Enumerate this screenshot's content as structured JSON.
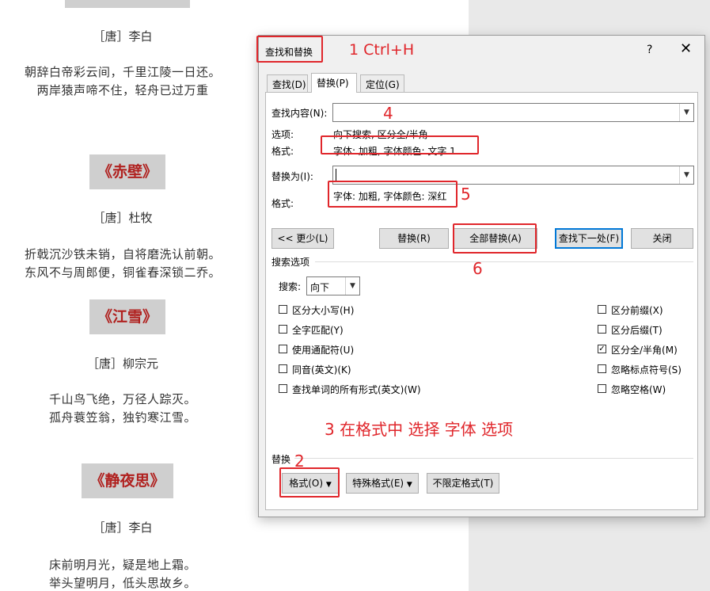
{
  "document": {
    "poems": [
      {
        "author": "［唐］李白",
        "lines": [
          "朝辞白帝彩云间，千里江陵一日还。",
          "两岸猿声啼不住，轻舟已过万重"
        ]
      },
      {
        "title": "《赤壁》",
        "author": "［唐］杜牧",
        "lines": [
          "折戟沉沙铁未销，自将磨洗认前朝。",
          "东风不与周郎便，铜雀春深锁二乔。"
        ]
      },
      {
        "title": "《江雪》",
        "author": "［唐］柳宗元",
        "lines": [
          "千山鸟飞绝，万径人踪灭。",
          "孤舟蓑笠翁，独钓寒江雪。"
        ]
      },
      {
        "title": "《静夜思》",
        "author": "［唐］李白",
        "lines": [
          "床前明月光，疑是地上霜。",
          "举头望明月，低头思故乡。"
        ]
      }
    ]
  },
  "dialog": {
    "title": "查找和替换",
    "help": "?",
    "close": "✕",
    "tabs": [
      "查找(D)",
      "替换(P)",
      "定位(G)"
    ],
    "find_label": "查找内容(N):",
    "find_value": "",
    "options_label": "选项:",
    "options_value": "向下搜索, 区分全/半角",
    "find_format_label": "格式:",
    "find_format_value": "字体: 加粗, 字体颜色: 文字 1",
    "replace_label": "替换为(I):",
    "replace_value": "",
    "replace_format_label": "格式:",
    "replace_format_value": "字体: 加粗, 字体颜色: 深红",
    "buttons": {
      "less": "<< 更少(L)",
      "replace": "替换(R)",
      "replace_all": "全部替换(A)",
      "find_next": "查找下一处(F)",
      "close": "关闭"
    },
    "search_options_label": "搜索选项",
    "search_label": "搜索:",
    "search_value": "向下",
    "checkboxes_left": [
      {
        "label": "区分大小写(H)",
        "checked": false
      },
      {
        "label": "全字匹配(Y)",
        "checked": false
      },
      {
        "label": "使用通配符(U)",
        "checked": false
      },
      {
        "label": "同音(英文)(K)",
        "checked": false
      },
      {
        "label": "查找单词的所有形式(英文)(W)",
        "checked": false
      }
    ],
    "checkboxes_right": [
      {
        "label": "区分前缀(X)",
        "checked": false
      },
      {
        "label": "区分后缀(T)",
        "checked": false
      },
      {
        "label": "区分全/半角(M)",
        "checked": true
      },
      {
        "label": "忽略标点符号(S)",
        "checked": false
      },
      {
        "label": "忽略空格(W)",
        "checked": false
      }
    ],
    "replace_section_label": "替换",
    "bottom_buttons": {
      "format": "格式(O)",
      "special": "特殊格式(E)",
      "no_format": "不限定格式(T)"
    }
  },
  "annotations": {
    "a1": "1 Ctrl+H",
    "a2": "2",
    "a3": "3 在格式中 选择 字体 选项",
    "a4": "4",
    "a5": "5",
    "a6": "6"
  },
  "colors": {
    "annotation": "#e0262b",
    "poem_title": "#b0211f",
    "button_focus": "#0078d7"
  }
}
